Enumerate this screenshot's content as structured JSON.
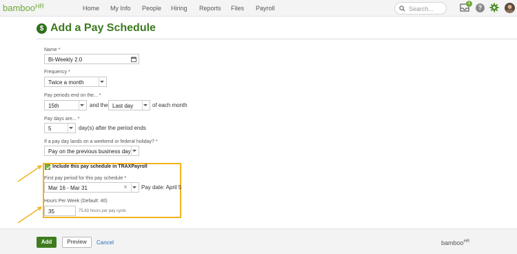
{
  "nav": {
    "logo": "bamboo",
    "logo_sup": "HR",
    "items": [
      "Home",
      "My Info",
      "People",
      "Hiring",
      "Reports",
      "Files",
      "Payroll"
    ],
    "search_placeholder": "Search...",
    "inbox_count": "1",
    "help": "?"
  },
  "page": {
    "title": "Add a Pay Schedule",
    "title_icon": "$"
  },
  "form": {
    "name_label": "Name",
    "name_value": "Bi-Weekly 2.0",
    "frequency_label": "Frequency",
    "frequency_value": "Twice a month",
    "periods_label": "Pay periods end on the...",
    "period_day": "15th",
    "and_the": "and the",
    "period_day2": "Last day",
    "of_each_month": "of each month",
    "paydays_label": "Pay days are...",
    "paydays_value": "5",
    "paydays_suffix": "day(s) after the period ends",
    "holiday_label": "If a pay day lands on a weekend or federal holiday?",
    "holiday_value": "Pay on the previous business day",
    "required_mark": "*",
    "trax_label": "Include this pay schedule in TRAXPayroll",
    "first_period_label": "First pay period for this pay schedule",
    "first_period_value": "Mar 16 - Mar 31",
    "clear": "×",
    "pay_date": "Pay date: April 5",
    "hours_label": "Hours Per Week (Default: 40)",
    "hours_value": "35",
    "hours_note": "75.83 hours per pay cycle"
  },
  "footer": {
    "add": "Add",
    "preview": "Preview",
    "cancel": "Cancel",
    "logo": "bamboo",
    "logo_sup": "HR"
  },
  "colors": {
    "brand_green": "#6ea83a",
    "title_green": "#3d7a20",
    "highlight": "#f2b21a",
    "link": "#2a6bb5"
  },
  "icons": [
    "search-icon",
    "inbox-icon",
    "help-icon",
    "gear-icon",
    "avatar",
    "dollar-icon",
    "calendar-icon",
    "checkbox-icon",
    "chevron-down-icon",
    "arrow-icon"
  ]
}
